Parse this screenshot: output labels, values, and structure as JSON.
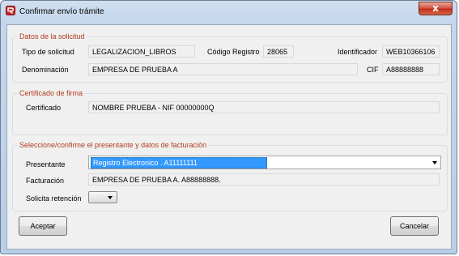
{
  "window": {
    "title": "Confirmar envío trámite",
    "close_label": "x"
  },
  "solicitud": {
    "legend": "Datos de la solicitud",
    "tipo_label": "Tipo de solicitud",
    "tipo_value": "LEGALIZACION_LIBROS",
    "codigo_label": "Código Registro",
    "codigo_value": "28065",
    "identificador_label": "Identificador",
    "identificador_value": "WEB10366106",
    "denominacion_label": "Denominación",
    "denominacion_value": "EMPRESA DE PRUEBA A",
    "cif_label": "CIF",
    "cif_value": "A88888888"
  },
  "certificado": {
    "legend": "Certificado de firma",
    "label": "Certificado",
    "value": "NOMBRE PRUEBA  - NIF 00000000Q"
  },
  "facturacion": {
    "legend": "Seleccione/confirme el presentante y datos de facturación",
    "presentante_label": "Presentante",
    "presentante_value": "Registro Electronico . A11111111",
    "facturacion_label": "Facturación",
    "facturacion_value": "EMPRESA DE PRUEBA A. A88888888.",
    "retencion_label": "Solicita retención",
    "retencion_value": ""
  },
  "buttons": {
    "accept": "Aceptar",
    "cancel": "Cancelar"
  },
  "colors": {
    "legend": "#b23b1f",
    "selection": "#3399ff",
    "close": "#c0301a"
  }
}
